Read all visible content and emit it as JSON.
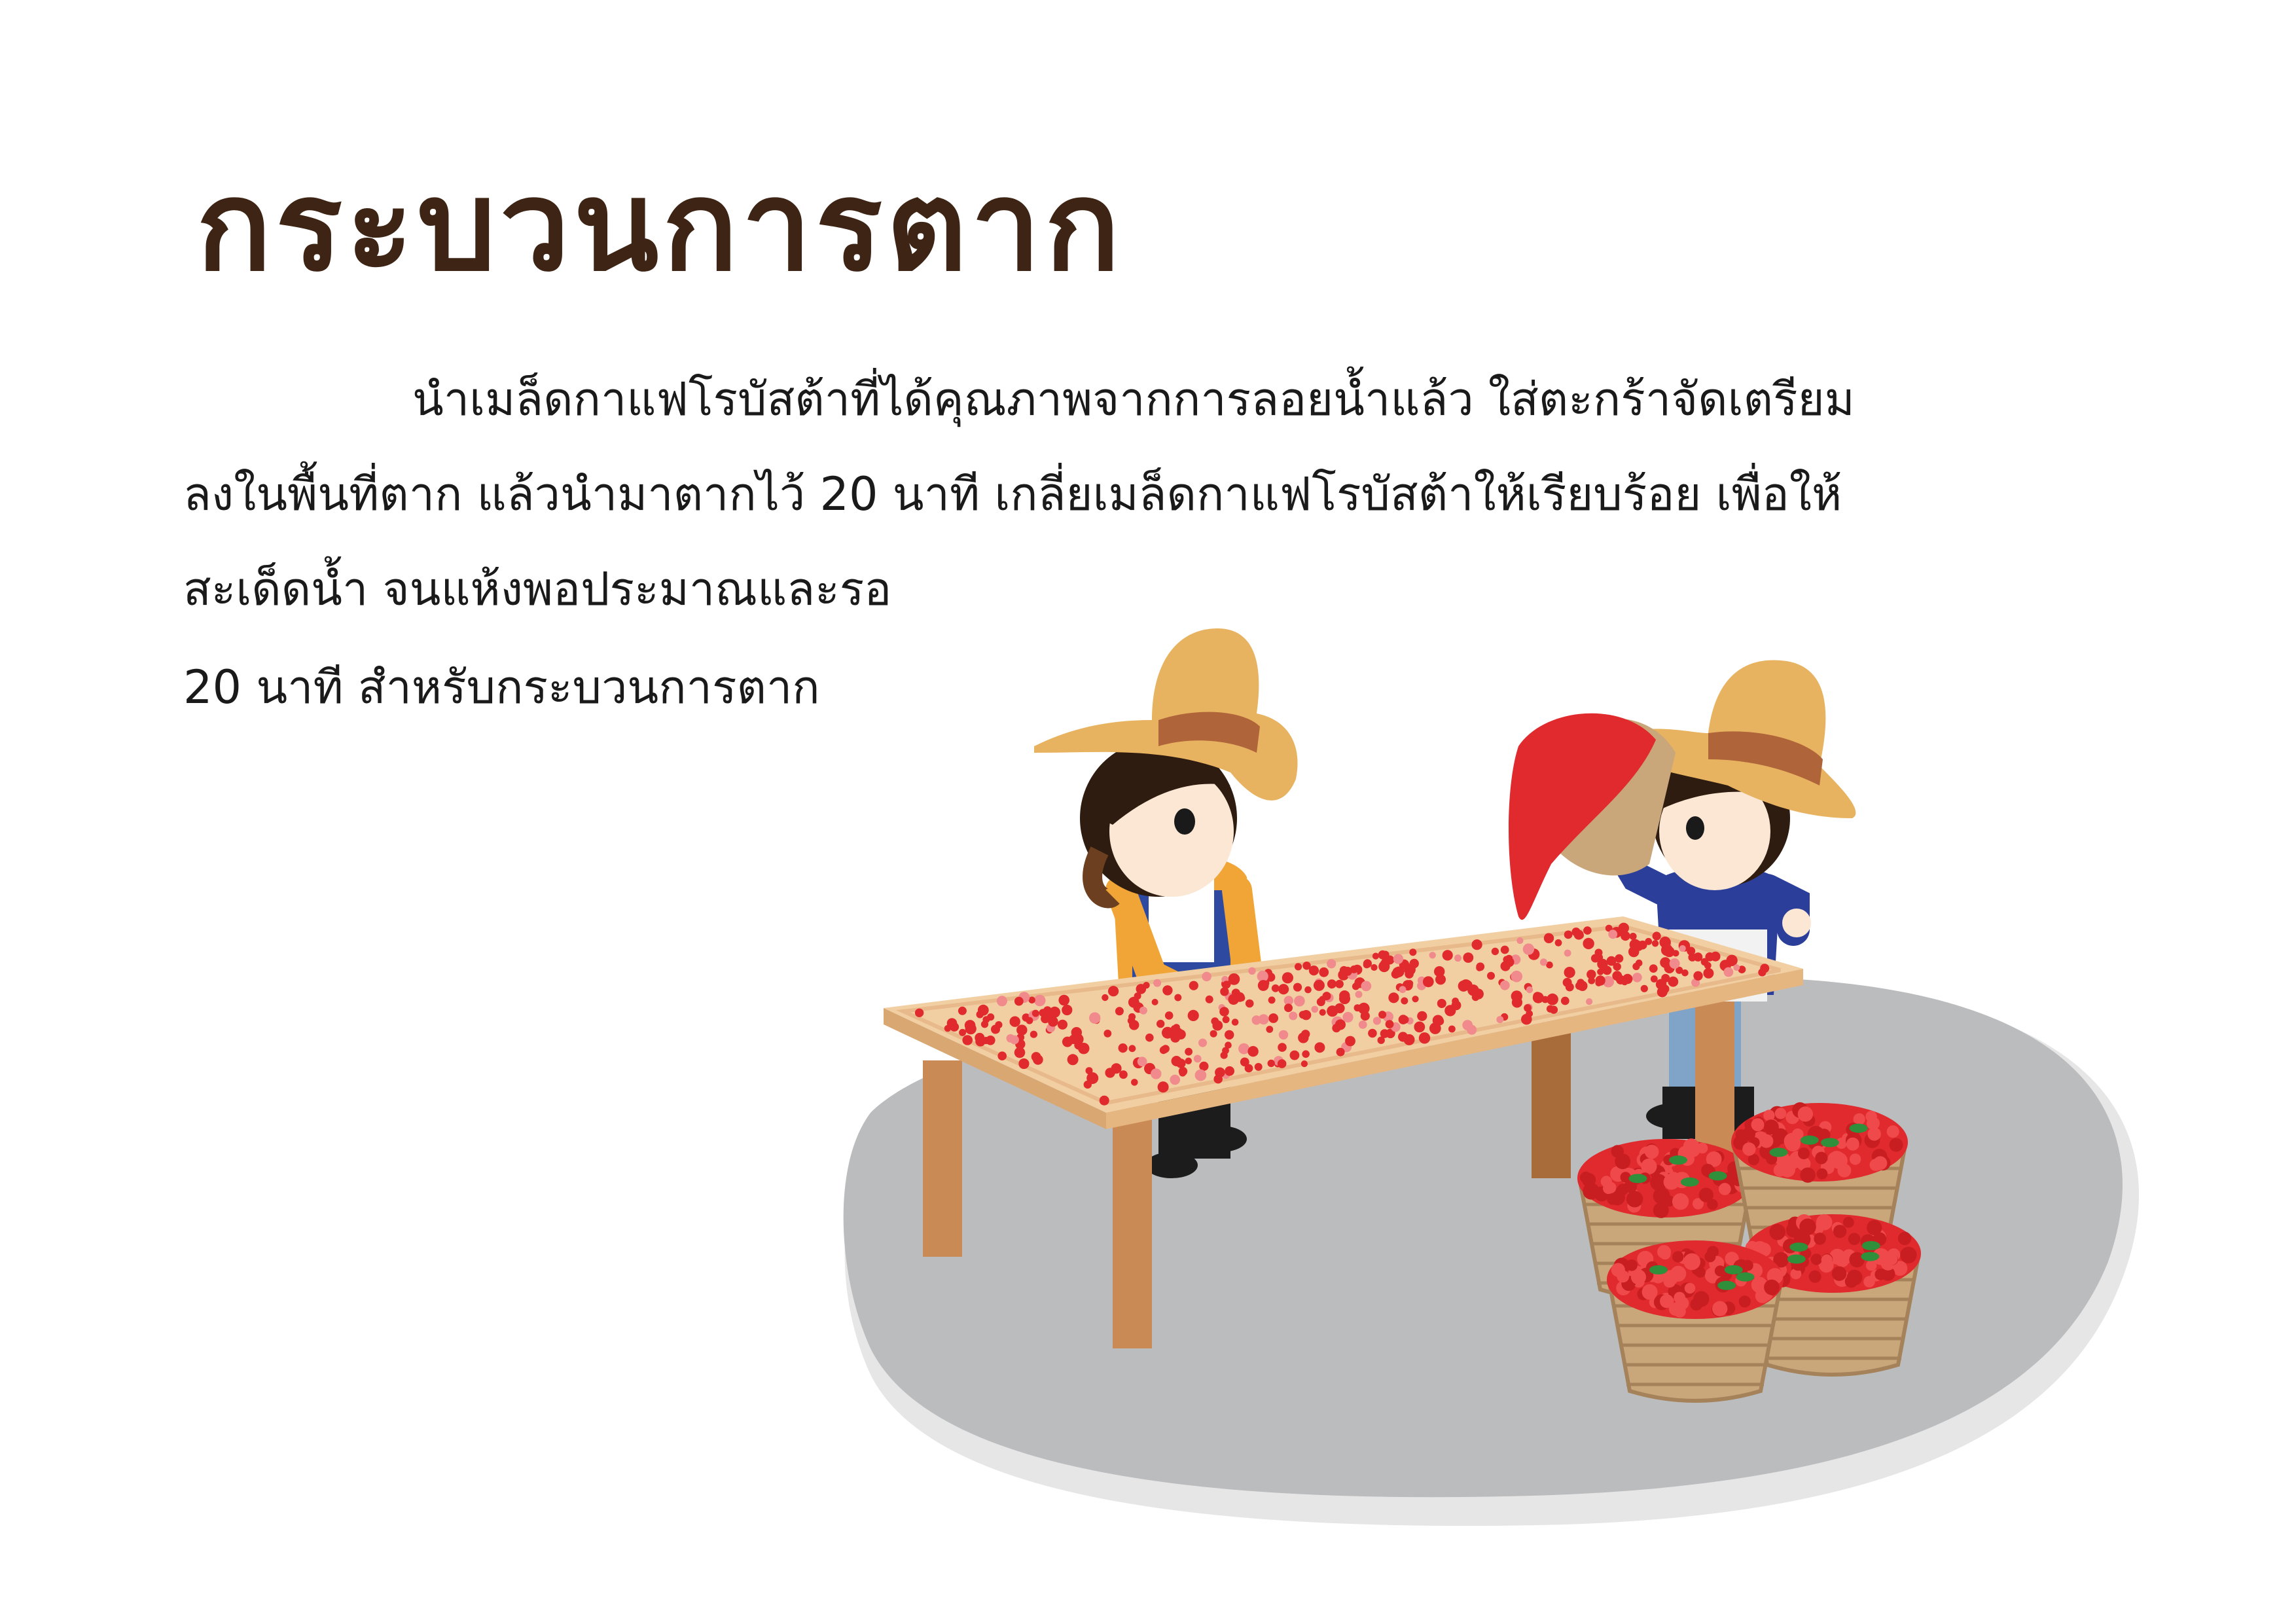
{
  "heading": "กระบวนการตาก",
  "paragraph": {
    "line1": "นำเมล็ดกาแฟโรบัสต้าที่ได้คุณภาพจากการลอยน้ำแล้ว ใส่ตะกร้าจัดเตรียม",
    "line2": "ลงในพื้นที่ตาก แล้วนำมาตากไว้ 20 นาที เกลี่ยเมล็ดกาแฟโรบัสต้าให้เรียบร้อย เพื่อให้",
    "line3": "สะเด็ดน้ำ จนแห้งพอประมาณและรอ",
    "line4": "20 นาที สำหรับกระบวนการตาก"
  },
  "illustration": {
    "subject": "two farmers drying red robusta coffee cherries on a wooden table, with baskets of cherries",
    "colors": {
      "ground": "#bbbcbe",
      "table_top": "#f2cfa2",
      "table_leg": "#c98a55",
      "cherry": "#e02a2d",
      "hat": "#e8b360",
      "shirt_blue": "#2b3e9a",
      "basket": "#c9a77a"
    }
  }
}
